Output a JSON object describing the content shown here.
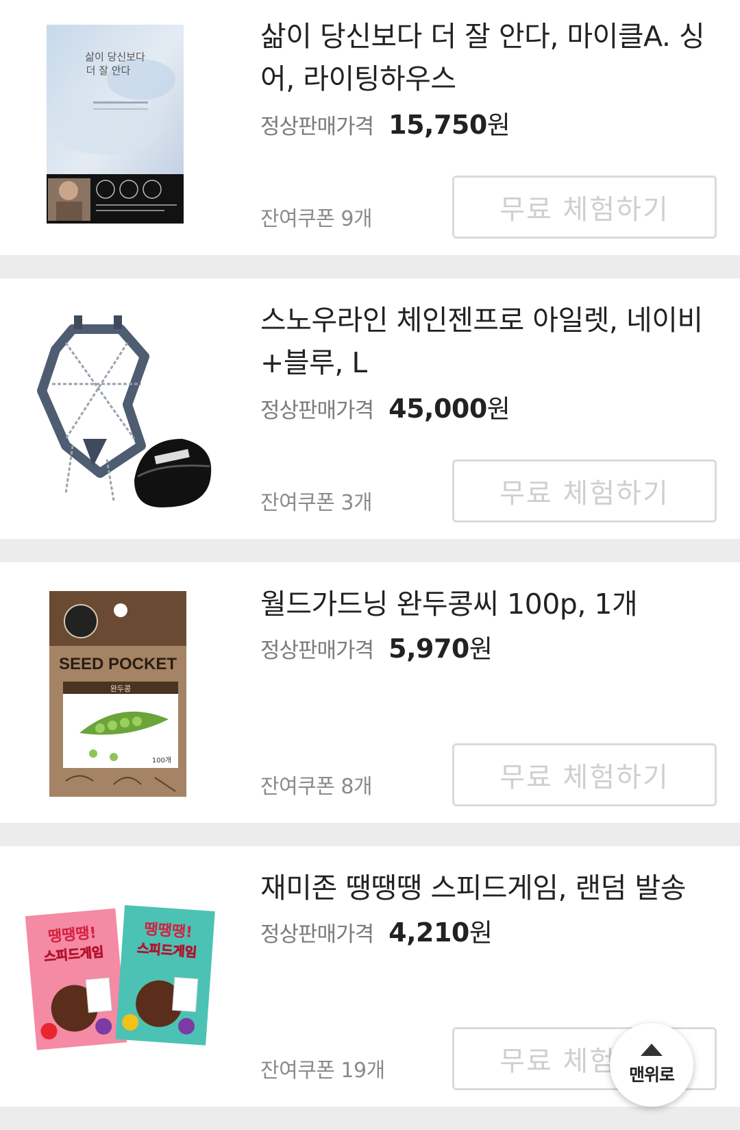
{
  "products": [
    {
      "title": "삶이 당신보다 더 잘 안다, 마이클A. 싱어, 라이팅하우스",
      "price_label": "정상판매가격",
      "price": "15,750",
      "price_unit": "원",
      "coupon": "잔여쿠폰 9개",
      "button": "무료 체험하기",
      "thumb_icon": "book-cover-image",
      "thumb_text": {
        "title_line1": "삶이 당신보다",
        "title_line2": "더 잘 안다"
      }
    },
    {
      "title": "스노우라인 체인젠프로 아일렛, 네이비+블루, L",
      "price_label": "정상판매가격",
      "price": "45,000",
      "price_unit": "원",
      "coupon": "잔여쿠폰 3개",
      "button": "무료 체험하기",
      "thumb_icon": "crampon-chain-image"
    },
    {
      "title": "월드가드닝 완두콩씨 100p, 1개",
      "price_label": "정상판매가격",
      "price": "5,970",
      "price_unit": "원",
      "coupon": "잔여쿠폰 8개",
      "button": "무료 체험하기",
      "thumb_icon": "seed-pocket-image",
      "thumb_text": {
        "brand": "SEED POCKET",
        "variety": "완두콩",
        "count": "100개"
      }
    },
    {
      "title": "재미존 땡땡땡 스피드게임, 랜덤 발송",
      "price_label": "정상판매가격",
      "price": "4,210",
      "price_unit": "원",
      "coupon": "잔여쿠폰 19개",
      "button": "무료 체험하기",
      "thumb_icon": "card-game-boxes-image",
      "thumb_text": {
        "line1": "땡땡땡!",
        "line2": "스피드게임"
      }
    }
  ],
  "scroll_top": {
    "label": "맨위로",
    "icon": "arrow-up-icon"
  },
  "colors": {
    "background": "#ececec",
    "card": "#ffffff",
    "title": "#222222",
    "muted": "#7a7a7a",
    "button_border": "#dadada",
    "button_text": "#cfcfcf"
  }
}
